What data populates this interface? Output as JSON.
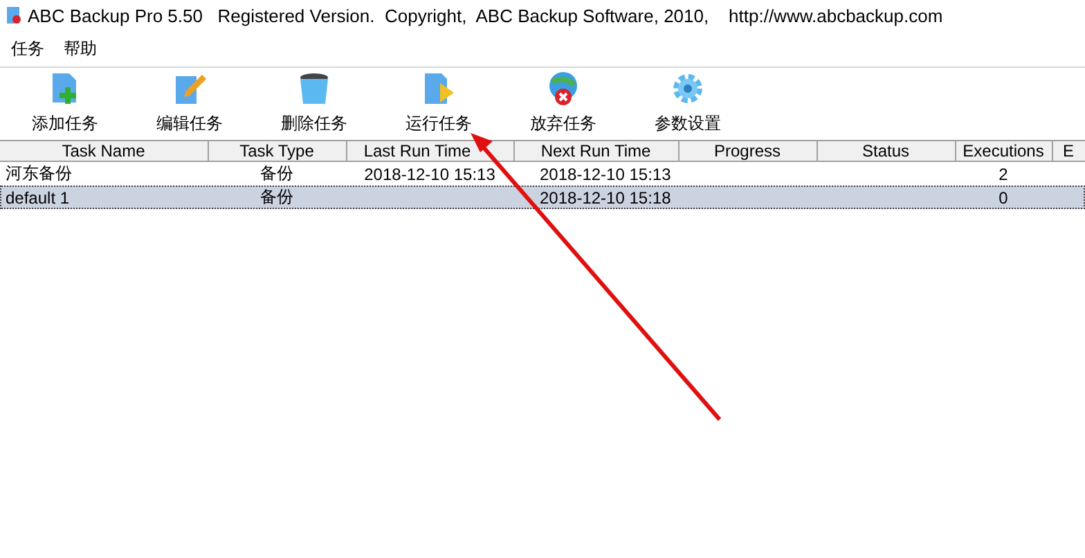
{
  "window": {
    "title": "ABC Backup Pro 5.50   Registered Version.  Copyright,  ABC Backup Software, 2010,    http://www.abcbackup.com"
  },
  "menu": [
    "任务",
    "帮助"
  ],
  "toolbar": [
    {
      "kind": "add",
      "label": "添加任务"
    },
    {
      "kind": "edit",
      "label": "编辑任务"
    },
    {
      "kind": "delete",
      "label": "删除任务"
    },
    {
      "kind": "run",
      "label": "运行任务"
    },
    {
      "kind": "abort",
      "label": "放弃任务"
    },
    {
      "kind": "settings",
      "label": "参数设置"
    }
  ],
  "table": {
    "columns": [
      "Task Name",
      "Task Type",
      "Last Run Time",
      "Next Run Time",
      "Progress",
      "Status",
      "Executions",
      "E"
    ],
    "rows": [
      {
        "selected": false,
        "cells": [
          "河东备份",
          "备份",
          "2018-12-10 15:13",
          "2018-12-10 15:13",
          "",
          "",
          "2",
          ""
        ]
      },
      {
        "selected": true,
        "cells": [
          "default 1",
          "备份",
          "",
          "2018-12-10 15:18",
          "",
          "",
          "0",
          ""
        ]
      }
    ]
  }
}
